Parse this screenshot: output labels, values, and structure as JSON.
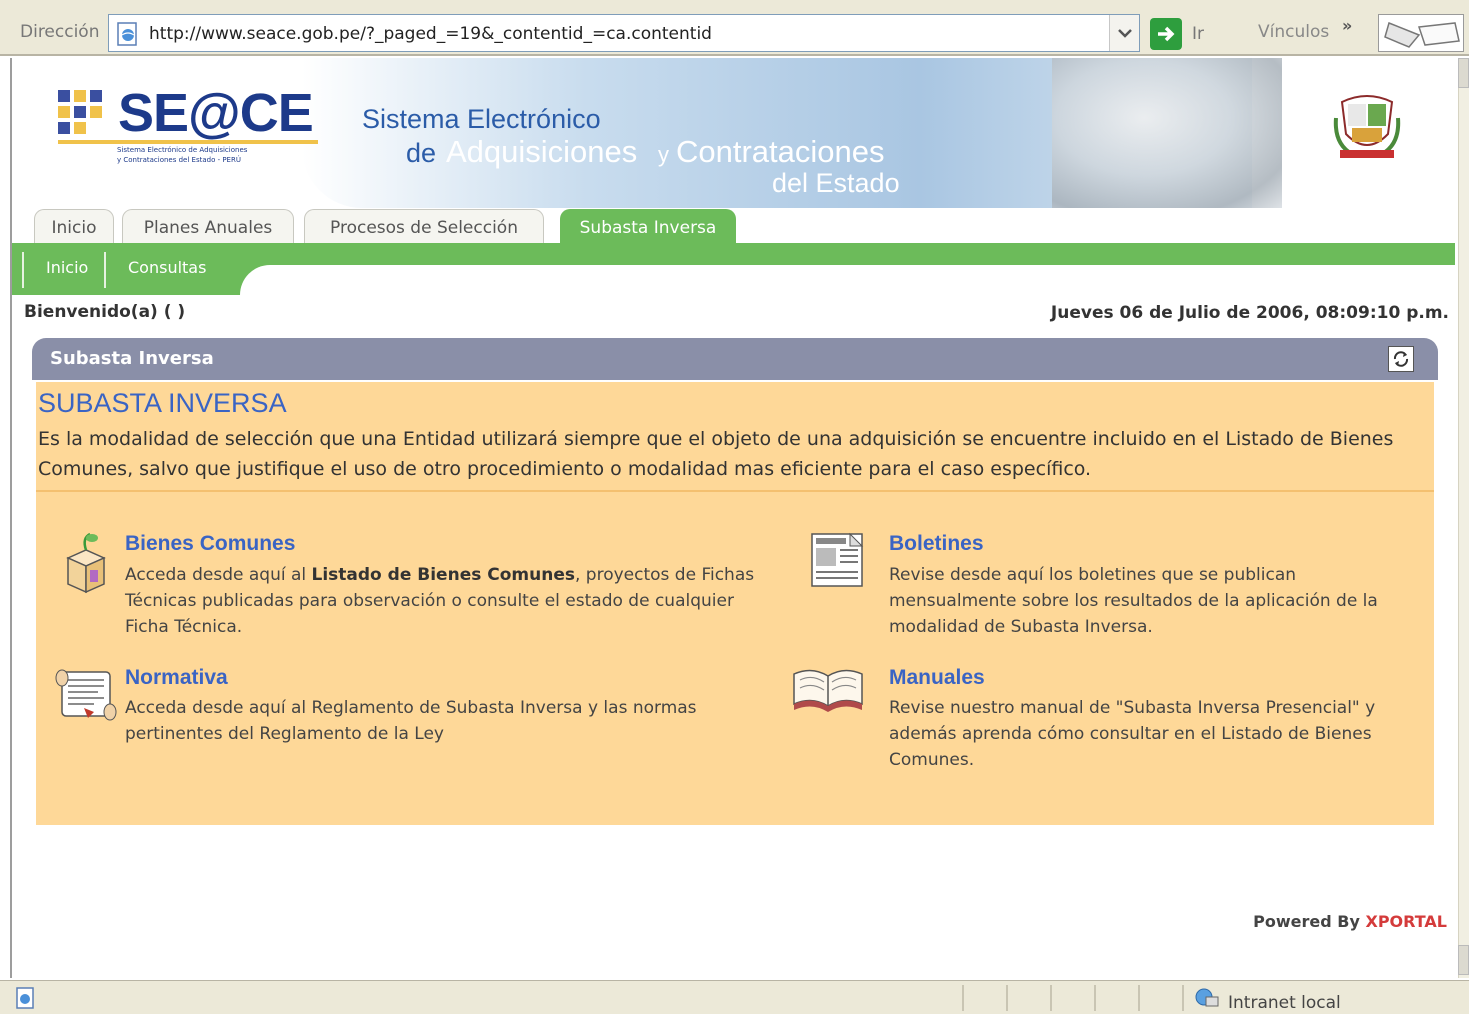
{
  "browser": {
    "address_label": "Dirección",
    "url": "http://www.seace.gob.pe/?_paged_=19&_contentid_=ca.contentid",
    "go_label": "Ir",
    "links_label": "Vínculos",
    "links_chevron": "»",
    "status_zone": "Intranet local"
  },
  "header": {
    "logo_text": "SE@CE",
    "logo_sub_line1": "Sistema Electrónico de Adquisiciones",
    "logo_sub_line2": "y Contrataciones del Estado - PERÚ",
    "tagline_line1": "Sistema Electrónico",
    "tagline_de": "de",
    "tagline_adquisiciones": "Adquisiciones",
    "tagline_y": "y",
    "tagline_contrataciones": "Contrataciones",
    "tagline_line3": "del Estado"
  },
  "tabs": [
    {
      "label": "Inicio"
    },
    {
      "label": "Planes Anuales"
    },
    {
      "label": "Procesos de Selección"
    },
    {
      "label": "Subasta Inversa"
    }
  ],
  "subnav": [
    {
      "label": "Inicio"
    },
    {
      "label": "Consultas"
    }
  ],
  "welcome": "Bienvenido(a) ( )",
  "datetime": "Jueves 06 de Julio de 2006, 08:09:10 p.m.",
  "panel": {
    "header_title": "Subasta Inversa",
    "intro_title": "SUBASTA INVERSA",
    "intro_text": "Es la modalidad de selección que una Entidad utilizará siempre que el objeto de una adquisición se encuentre incluido en el Listado de Bienes Comunes, salvo que justifique el uso de otro procedimiento o modalidad mas eficiente para el caso específico."
  },
  "cards": {
    "bienes": {
      "title": "Bienes Comunes",
      "text_before": "Acceda desde aquí al ",
      "text_bold": "Listado de Bienes Comunes",
      "text_after": ", proyectos de Fichas Técnicas publicadas para observación o consulte el estado de cualquier Ficha Técnica."
    },
    "boletines": {
      "title": "Boletines",
      "text": "Revise desde aquí los boletines que se publican mensualmente sobre los resultados de la aplicación de la modalidad de Subasta Inversa."
    },
    "normativa": {
      "title": "Normativa",
      "text": "Acceda desde aquí al Reglamento de Subasta Inversa y las normas pertinentes del Reglamento de la Ley"
    },
    "manuales": {
      "title": "Manuales",
      "text": "Revise nuestro manual de \"Subasta Inversa Presencial\" y además aprenda cómo consultar en el Listado de Bienes Comunes."
    }
  },
  "footer": {
    "powered_prefix": "Powered By ",
    "powered_brand": "XPORTAL"
  },
  "colors": {
    "tab_active": "#6cbb5a",
    "panel_bg": "#fed898",
    "panel_header": "#8a8fa8",
    "link_blue": "#3a64c4",
    "brand_red": "#d43b3b"
  }
}
